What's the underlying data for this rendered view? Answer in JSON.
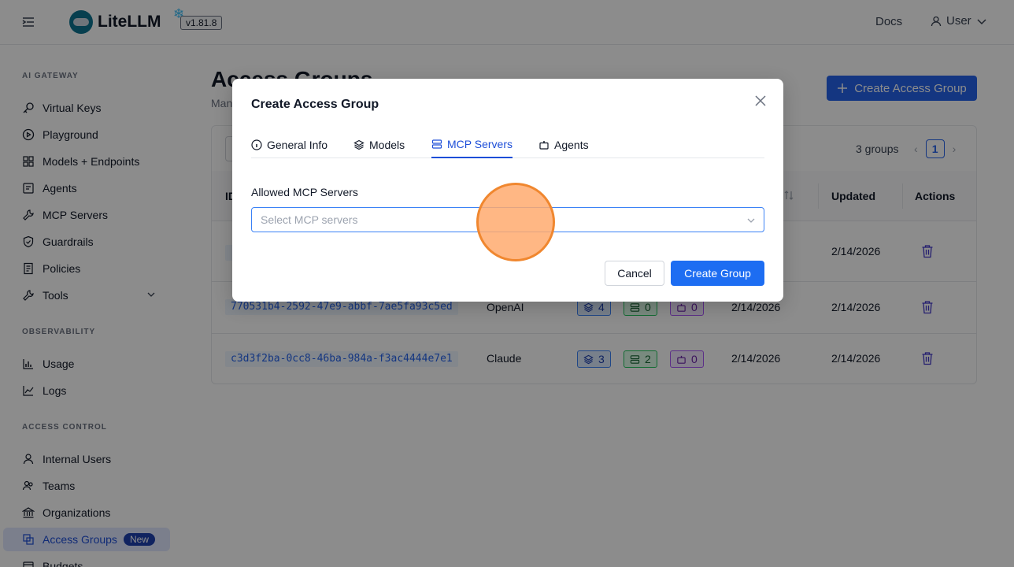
{
  "header": {
    "logo_text": "LiteLLM",
    "version": "v1.81.8",
    "docs_label": "Docs",
    "user_label": "User"
  },
  "sidebar": {
    "sections": [
      {
        "title": "AI GATEWAY"
      },
      {
        "title": "OBSERVABILITY"
      },
      {
        "title": "ACCESS CONTROL"
      }
    ],
    "items": [
      {
        "label": "Virtual Keys",
        "icon": "key-icon"
      },
      {
        "label": "Playground",
        "icon": "play-icon"
      },
      {
        "label": "Models + Endpoints",
        "icon": "models-icon"
      },
      {
        "label": "Agents",
        "icon": "agents-icon"
      },
      {
        "label": "MCP Servers",
        "icon": "tool-icon"
      },
      {
        "label": "Guardrails",
        "icon": "shield-icon"
      },
      {
        "label": "Policies",
        "icon": "policy-icon"
      },
      {
        "label": "Tools",
        "icon": "wrench-icon"
      },
      {
        "label": "Usage",
        "icon": "bar-chart-icon"
      },
      {
        "label": "Logs",
        "icon": "line-chart-icon"
      },
      {
        "label": "Internal Users",
        "icon": "user-icon"
      },
      {
        "label": "Teams",
        "icon": "team-icon"
      },
      {
        "label": "Organizations",
        "icon": "bank-icon"
      },
      {
        "label": "Access Groups",
        "icon": "access-groups-icon",
        "badge": "New"
      },
      {
        "label": "Budgets",
        "icon": "budget-icon"
      }
    ]
  },
  "main": {
    "title": "Access Groups",
    "subtitle": "Man",
    "create_button": "Create Access Group",
    "groups_count": "3 groups",
    "page_number": "1",
    "columns": {
      "id": "ID",
      "updated": "Updated",
      "actions": "Actions"
    },
    "rows": [
      {
        "id": "",
        "name": "",
        "models": "",
        "mcp": "",
        "agents": "",
        "created": "",
        "updated": "2/14/2026"
      },
      {
        "id": "770531b4-2592-47e9-abbf-7ae5fa93c5ed",
        "name": "OpenAI",
        "models": "4",
        "mcp": "0",
        "agents": "0",
        "created": "2/14/2026",
        "updated": "2/14/2026"
      },
      {
        "id": "c3d3f2ba-0cc8-46ba-984a-f3ac4444e7e1",
        "name": "Claude",
        "models": "3",
        "mcp": "2",
        "agents": "0",
        "created": "2/14/2026",
        "updated": "2/14/2026"
      }
    ]
  },
  "modal": {
    "title": "Create Access Group",
    "tabs": [
      {
        "label": "General Info",
        "icon": "info-icon"
      },
      {
        "label": "Models",
        "icon": "layers-icon"
      },
      {
        "label": "MCP Servers",
        "icon": "server-icon",
        "active": true
      },
      {
        "label": "Agents",
        "icon": "robot-icon"
      }
    ],
    "field_label": "Allowed MCP Servers",
    "select_placeholder": "Select MCP servers",
    "cancel_label": "Cancel",
    "submit_label": "Create Group"
  },
  "colors": {
    "accent": "#1d6df2",
    "active_tab": "#1d4ed8",
    "overlay": "rgba(0,0,0,0.45)"
  }
}
